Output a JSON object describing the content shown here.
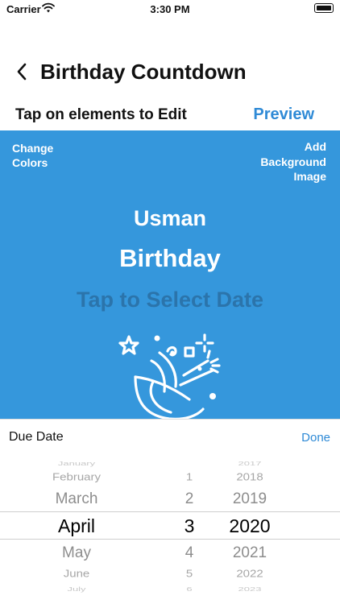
{
  "status_bar": {
    "carrier": "Carrier",
    "time": "3:30 PM"
  },
  "nav": {
    "title": "Birthday Countdown",
    "back_icon": "chevron-left-icon"
  },
  "editor": {
    "hint": "Tap on elements to Edit",
    "preview_label": "Preview"
  },
  "card": {
    "background_color": "#3597dc",
    "change_colors_line1": "Change",
    "change_colors_line2": "Colors",
    "add_bg_line1": "Add",
    "add_bg_line2": "Background",
    "add_bg_line3": "Image",
    "name": "Usman",
    "event": "Birthday",
    "date_placeholder": "Tap to Select Date",
    "illustration_icon": "party-popper-icon"
  },
  "picker": {
    "label": "Due Date",
    "done_label": "Done",
    "accent_color": "#2f8ad6",
    "months": [
      "January",
      "February",
      "March",
      "April",
      "May",
      "June",
      "July"
    ],
    "days": [
      "",
      "1",
      "2",
      "3",
      "4",
      "5",
      "6"
    ],
    "years": [
      "2017",
      "2018",
      "2019",
      "2020",
      "2021",
      "2022",
      "2023"
    ],
    "selected": {
      "month": "April",
      "day": "3",
      "year": "2020"
    }
  }
}
